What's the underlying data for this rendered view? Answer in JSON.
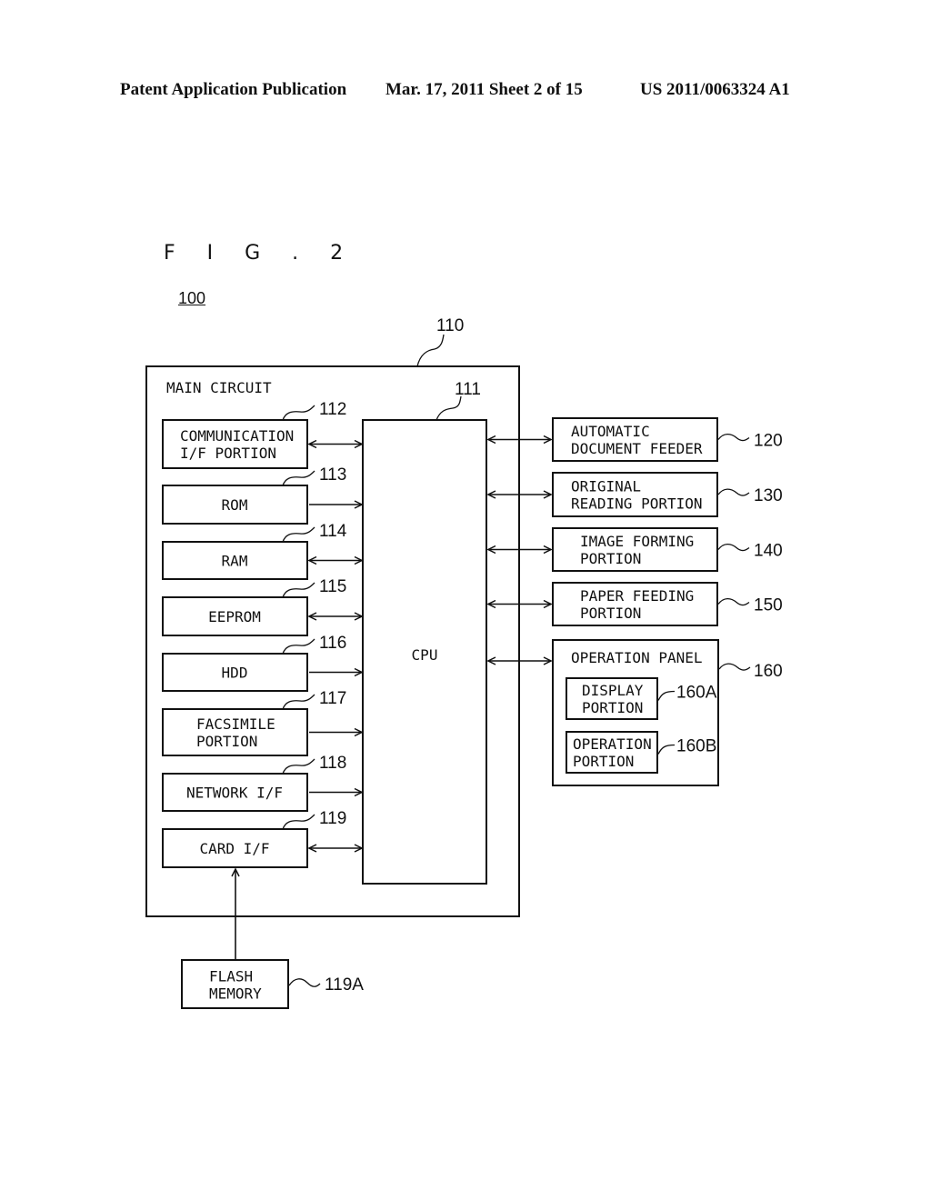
{
  "header": {
    "publication": "Patent Application Publication",
    "date_sheet": "Mar. 17, 2011  Sheet 2 of 15",
    "patent_number": "US 2011/0063324 A1"
  },
  "figure": {
    "title": "F I G . 2",
    "system_ref": "100"
  },
  "main_circuit": {
    "label": "MAIN CIRCUIT",
    "ref": "110",
    "cpu": {
      "label": "CPU",
      "ref": "111"
    },
    "components": [
      {
        "lines": [
          "COMMUNICATION",
          "I/F PORTION"
        ],
        "ref": "112",
        "link": "bidirectional"
      },
      {
        "lines": [
          "ROM"
        ],
        "ref": "113",
        "link": "to-cpu"
      },
      {
        "lines": [
          "RAM"
        ],
        "ref": "114",
        "link": "bidirectional"
      },
      {
        "lines": [
          "EEPROM"
        ],
        "ref": "115",
        "link": "bidirectional"
      },
      {
        "lines": [
          "HDD"
        ],
        "ref": "116",
        "link": "to-cpu"
      },
      {
        "lines": [
          "FACSIMILE",
          "PORTION"
        ],
        "ref": "117",
        "link": "to-cpu"
      },
      {
        "lines": [
          "NETWORK I/F"
        ],
        "ref": "118",
        "link": "to-cpu"
      },
      {
        "lines": [
          "CARD I/F"
        ],
        "ref": "119",
        "link": "bidirectional"
      }
    ]
  },
  "peripherals": [
    {
      "lines": [
        "AUTOMATIC",
        "DOCUMENT FEEDER"
      ],
      "ref": "120",
      "link": "bidirectional"
    },
    {
      "lines": [
        "ORIGINAL",
        "READING PORTION"
      ],
      "ref": "130",
      "link": "bidirectional"
    },
    {
      "lines": [
        "IMAGE FORMING",
        "PORTION"
      ],
      "ref": "140",
      "link": "bidirectional"
    },
    {
      "lines": [
        "PAPER FEEDING",
        "PORTION"
      ],
      "ref": "150",
      "link": "bidirectional"
    }
  ],
  "operation_panel": {
    "label": "OPERATION PANEL",
    "ref": "160",
    "link": "bidirectional",
    "sub": [
      {
        "lines": [
          "DISPLAY",
          "PORTION"
        ],
        "ref": "160A"
      },
      {
        "lines": [
          "OPERATION",
          "PORTION"
        ],
        "ref": "160B"
      }
    ]
  },
  "external": {
    "lines": [
      "FLASH",
      "MEMORY"
    ],
    "ref": "119A",
    "link": "to-card-if"
  }
}
